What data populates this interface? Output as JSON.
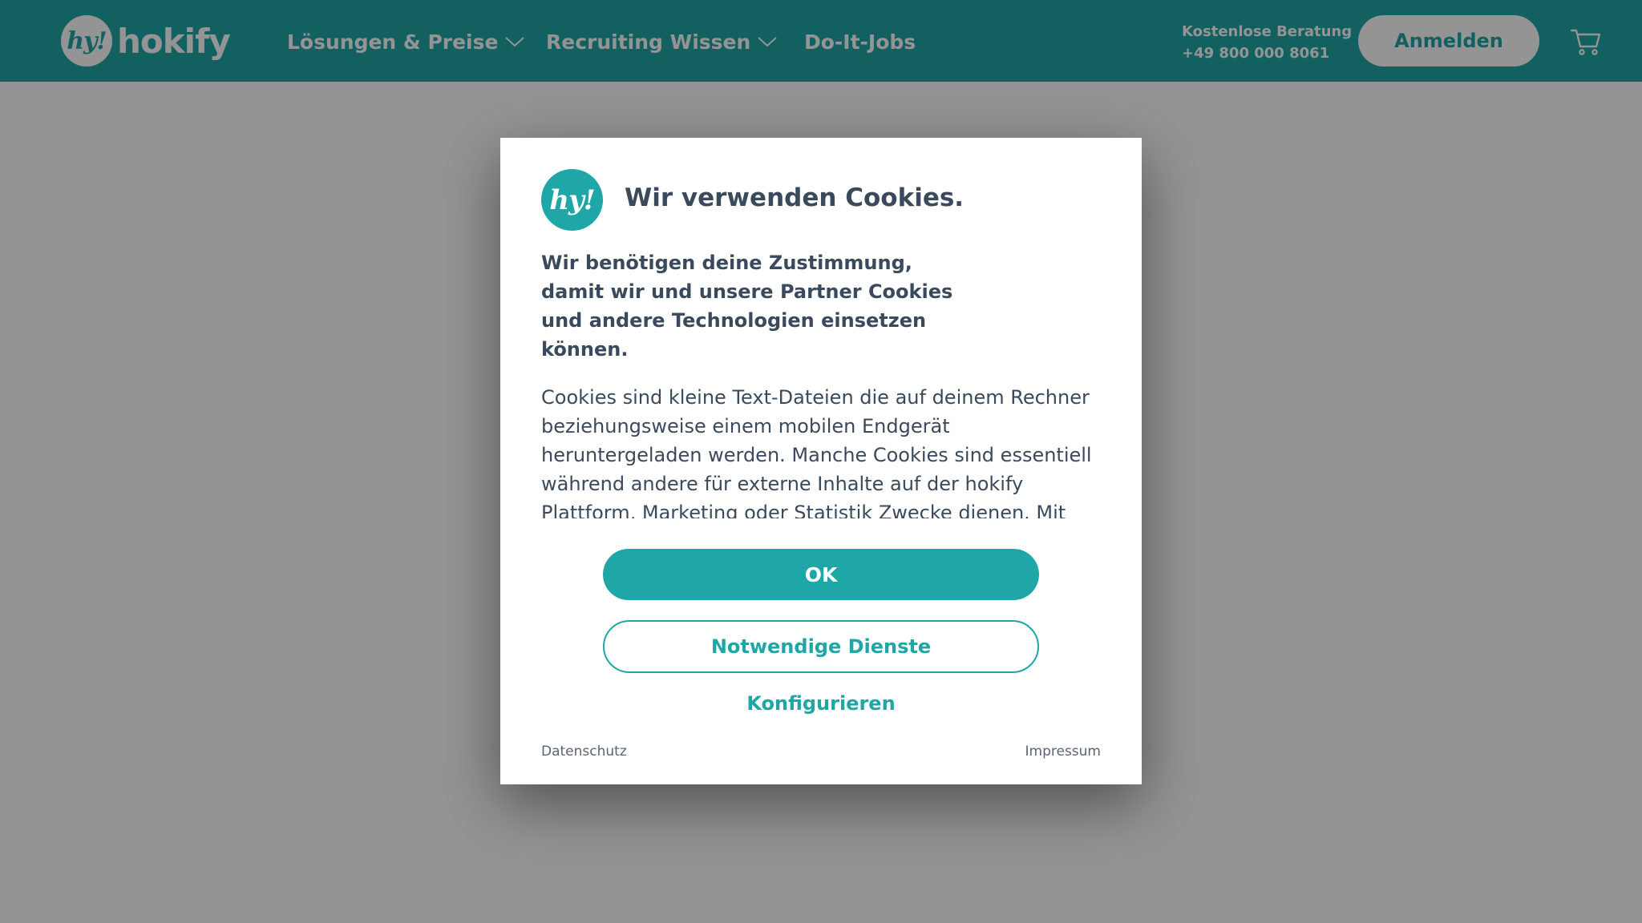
{
  "header": {
    "brand": "hokify",
    "logo_mark": "hy!",
    "nav": [
      {
        "label": "Lösungen & Preise",
        "icon": "chevron-down-icon"
      },
      {
        "label": "Recruiting Wissen",
        "icon": "chevron-down-icon"
      },
      {
        "label": "Do-It-Jobs"
      }
    ],
    "consult_title": "Kostenlose Beratung",
    "consult_phone": "+49 800 000 8061",
    "login_label": "Anmelden",
    "cart_icon": "cart-icon"
  },
  "modal": {
    "logo_mark": "hy!",
    "title": "Wir verwenden Cookies.",
    "lead": "Wir benötigen deine Zustimmung, damit wir und unsere Partner Cookies und andere Technologien einsetzen können.",
    "description": "Cookies sind kleine Text-Dateien die auf deinem Rechner beziehungsweise einem mobilen Endgerät heruntergeladen werden. Manche Cookies sind essentiell während andere für externe Inhalte auf der hokify Plattform, Marketing oder Statistik Zwecke dienen. Mit dem Button OK stimmst du allen Cookies (jederzeit widerruflich) zu. Unter Einstellungen",
    "ok_label": "OK",
    "necessary_label": "Notwendige Dienste",
    "configure_label": "Konfigurieren",
    "privacy_label": "Datenschutz",
    "imprint_label": "Impressum"
  },
  "colors": {
    "brand": "#1fa6a6",
    "text": "#3a4a5c",
    "overlay": "rgba(0,0,0,0.42)"
  }
}
